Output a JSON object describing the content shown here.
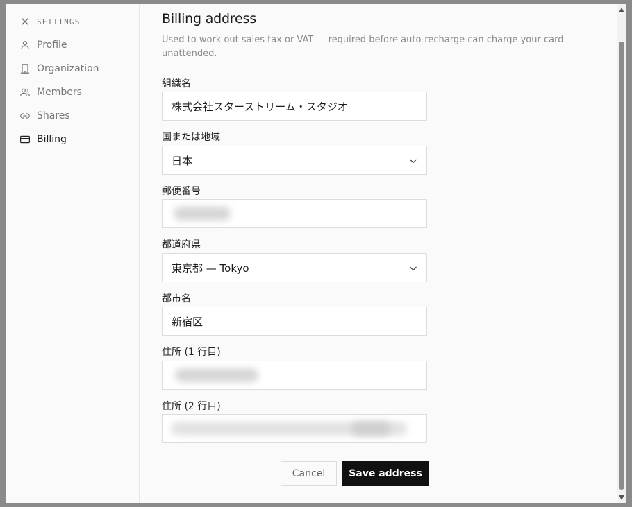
{
  "sidebar": {
    "header": "SETTINGS",
    "items": [
      {
        "label": "Profile",
        "icon": "user-icon"
      },
      {
        "label": "Organization",
        "icon": "building-icon"
      },
      {
        "label": "Members",
        "icon": "users-icon"
      },
      {
        "label": "Shares",
        "icon": "link-icon"
      },
      {
        "label": "Billing",
        "icon": "credit-card-icon",
        "active": true
      }
    ]
  },
  "main": {
    "title": "Billing address",
    "description": "Used to work out sales tax or VAT — required before auto-recharge can charge your card unattended.",
    "fields": {
      "org_name": {
        "label": "組織名",
        "value": "株式会社スターストリーム・スタジオ"
      },
      "country": {
        "label": "国または地域",
        "value": "日本"
      },
      "postal": {
        "label": "郵便番号",
        "value": ""
      },
      "prefecture": {
        "label": "都道府県",
        "value": "東京都 — Tokyo"
      },
      "city": {
        "label": "都市名",
        "value": "新宿区"
      },
      "address1": {
        "label": "住所 (1 行目)",
        "value": ""
      },
      "address2": {
        "label": "住所 (2 行目)",
        "value": ""
      }
    },
    "actions": {
      "cancel": "Cancel",
      "save": "Save address"
    }
  },
  "colors": {
    "primary_button": "#111111",
    "background": "#fafafa",
    "border": "#dcdcdc"
  }
}
